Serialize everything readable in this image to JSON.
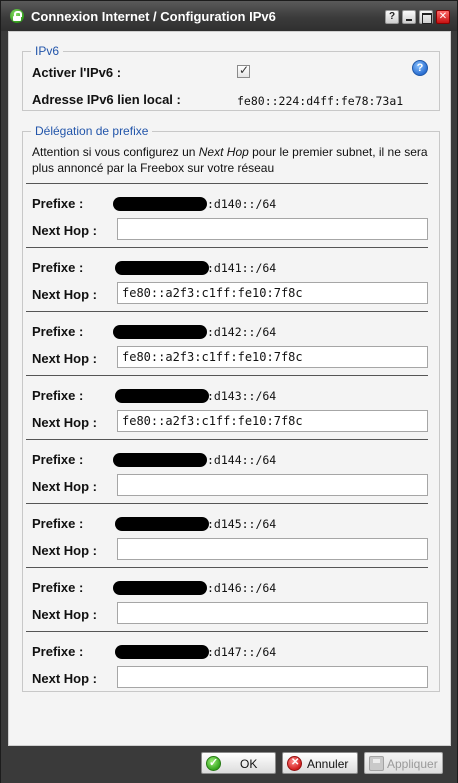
{
  "window": {
    "title": "Connexion Internet / Configuration IPv6",
    "help_glyph": "?",
    "icons": [
      "app-lock-icon",
      "help-icon",
      "minimize-icon",
      "maximize-icon",
      "close-icon"
    ]
  },
  "ipv6": {
    "legend": "IPv6",
    "enable_label": "Activer l'IPv6 :",
    "enabled": true,
    "help_glyph": "?",
    "local_address_label": "Adresse IPv6 lien local :",
    "local_address_value": "fe80::224:d4ff:fe78:73a1"
  },
  "delegation": {
    "legend": "Délégation de prefixe",
    "warning_part1": "Attention si vous configurez un ",
    "warning_emphasis": "Next Hop",
    "warning_part2": " pour le premier subnet, il ne sera plus annoncé par la Freebox sur votre réseau",
    "prefix_label": "Prefixe :",
    "next_hop_label": "Next Hop :",
    "rows": [
      {
        "prefix_suffix": ":d140::/64",
        "next_hop": ""
      },
      {
        "prefix_suffix": ":d141::/64",
        "next_hop": "fe80::a2f3:c1ff:fe10:7f8c"
      },
      {
        "prefix_suffix": ":d142::/64",
        "next_hop": "fe80::a2f3:c1ff:fe10:7f8c"
      },
      {
        "prefix_suffix": ":d143::/64",
        "next_hop": "fe80::a2f3:c1ff:fe10:7f8c"
      },
      {
        "prefix_suffix": ":d144::/64",
        "next_hop": ""
      },
      {
        "prefix_suffix": ":d145::/64",
        "next_hop": ""
      },
      {
        "prefix_suffix": ":d146::/64",
        "next_hop": ""
      },
      {
        "prefix_suffix": ":d147::/64",
        "next_hop": ""
      }
    ]
  },
  "footer": {
    "ok_label": "OK",
    "cancel_label": "Annuler",
    "apply_label": "Appliquer",
    "apply_disabled": true
  },
  "colors": {
    "legend_text": "#2255aa",
    "titlebar": "#3b3b3b",
    "close_button": "#c61111"
  }
}
